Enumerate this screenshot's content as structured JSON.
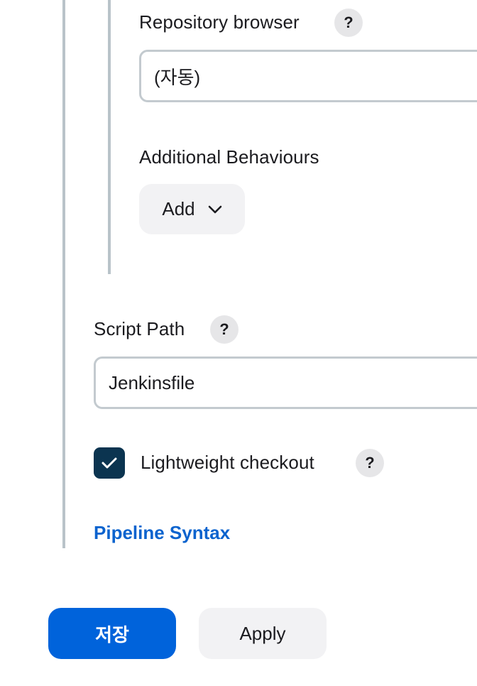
{
  "repository_browser": {
    "label": "Repository browser",
    "help": "?",
    "value": "(자동)"
  },
  "additional_behaviours": {
    "label": "Additional Behaviours",
    "add_button": "Add",
    "add_icon": "chevron-down-icon"
  },
  "script_path": {
    "label": "Script Path",
    "help": "?",
    "value": "Jenkinsfile"
  },
  "lightweight_checkout": {
    "label": "Lightweight checkout",
    "checked": true,
    "help": "?"
  },
  "pipeline_syntax_link": "Pipeline Syntax",
  "footer": {
    "save_label": "저장",
    "apply_label": "Apply"
  },
  "colors": {
    "primary": "#0063db",
    "link": "#0b63ce",
    "checkbox": "#0b3450",
    "rail": "#b9c3c9"
  }
}
